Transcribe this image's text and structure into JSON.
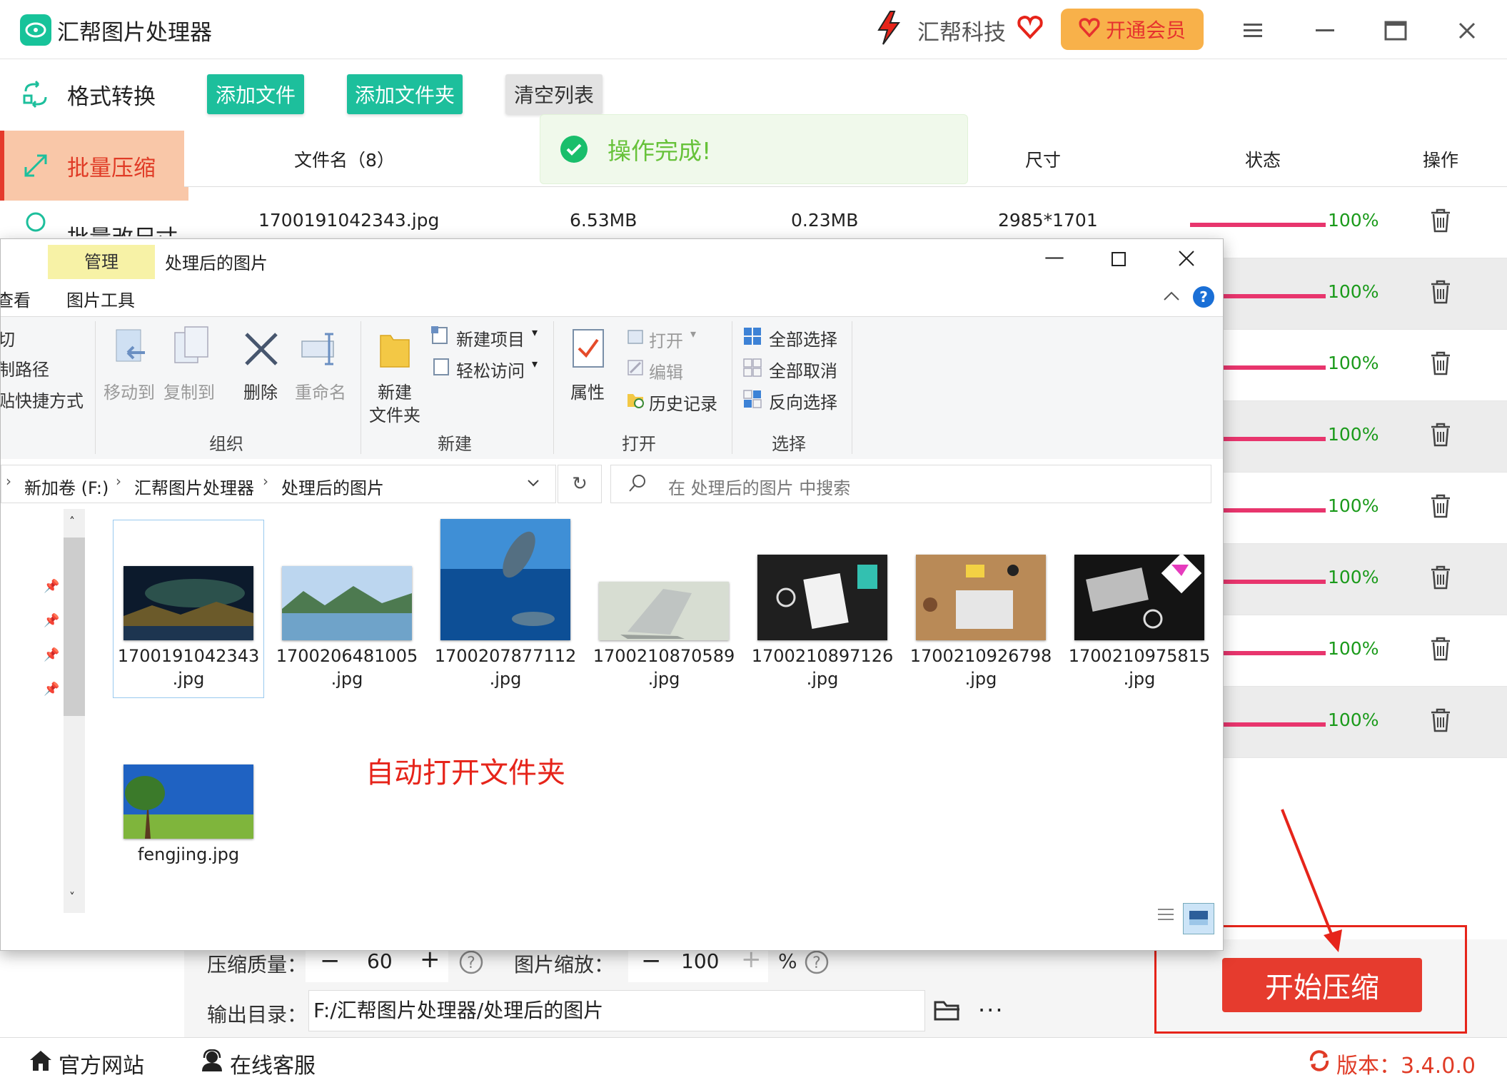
{
  "app": {
    "title": "汇帮图片处理器",
    "brand": "汇帮科技",
    "vip_button": "开通会员"
  },
  "sidebar": {
    "items": [
      {
        "label": "格式转换",
        "icon": "format-convert-icon"
      },
      {
        "label": "批量压缩",
        "icon": "compress-icon",
        "active": true
      },
      {
        "label": "批量改尺寸",
        "icon": "resize-icon"
      }
    ]
  },
  "toolbar": {
    "add_file": "添加文件",
    "add_folder": "添加文件夹",
    "clear_list": "清空列表"
  },
  "toast": {
    "text": "操作完成!"
  },
  "table": {
    "headers": {
      "filename": "文件名（8）",
      "size": "尺寸",
      "status": "状态",
      "action": "操作"
    },
    "rows": [
      {
        "filename": "1700191042343.jpg",
        "original": "6.53MB",
        "compressed": "0.23MB",
        "dimensions": "2985*1701",
        "progress": "100%"
      },
      {
        "progress": "100%"
      },
      {
        "progress": "100%"
      },
      {
        "progress": "100%"
      },
      {
        "progress": "100%"
      },
      {
        "progress": "100%"
      },
      {
        "progress": "100%"
      },
      {
        "progress": "100%"
      }
    ]
  },
  "explorer": {
    "manage_tab": "管理",
    "window_title": "处理后的图片",
    "tab_view": "查看",
    "tab_picture_tools": "图片工具",
    "ribbon": {
      "cut": "切",
      "copy_path": "制路径",
      "paste_shortcut": "贴快捷方式",
      "move_to": "移动到",
      "copy_to": "复制到",
      "delete": "删除",
      "rename": "重命名",
      "new_folder_line1": "新建",
      "new_folder_line2": "文件夹",
      "new_item": "新建项目",
      "easy_access": "轻松访问",
      "properties": "属性",
      "open": "打开",
      "edit": "编辑",
      "history": "历史记录",
      "select_all": "全部选择",
      "select_none": "全部取消",
      "invert_selection": "反向选择",
      "group_organize": "组织",
      "group_new": "新建",
      "group_open": "打开",
      "group_select": "选择"
    },
    "breadcrumb": [
      "新加卷 (F:)",
      "汇帮图片处理器",
      "处理后的图片"
    ],
    "search_placeholder": "在 处理后的图片 中搜索",
    "files": [
      {
        "line1": "1700191042343",
        "line2": ".jpg",
        "thumb": "night-lake"
      },
      {
        "line1": "1700206481005",
        "line2": ".jpg",
        "thumb": "mountain-lake"
      },
      {
        "line1": "1700207877112",
        "line2": ".jpg",
        "thumb": "dolphins"
      },
      {
        "line1": "1700210870589",
        "line2": ".jpg",
        "thumb": "laptop"
      },
      {
        "line1": "1700210897126",
        "line2": ".jpg",
        "thumb": "desk-writing"
      },
      {
        "line1": "1700210926798",
        "line2": ".jpg",
        "thumb": "desk-laptop"
      },
      {
        "line1": "1700210975815",
        "line2": ".jpg",
        "thumb": "desk-keyboard"
      },
      {
        "line1": "fengjing.jpg",
        "line2": "",
        "thumb": "tree-field"
      }
    ]
  },
  "annotation": "自动打开文件夹",
  "settings": {
    "quality_label": "压缩质量：",
    "quality_value": "60",
    "scale_label": "图片缩放：",
    "scale_value": "100",
    "scale_unit": "%",
    "output_label": "输出目录：",
    "output_path": "F:/汇帮图片处理器/处理后的图片"
  },
  "start_button": "开始压缩",
  "footer": {
    "website": "官方网站",
    "support": "在线客服",
    "version": "版本：3.4.0.0"
  },
  "colors": {
    "accent_green": "#1dbf9c",
    "accent_red": "#e63b2e",
    "progress_bar": "#e8356d",
    "progress_text": "#1a9a1a"
  }
}
